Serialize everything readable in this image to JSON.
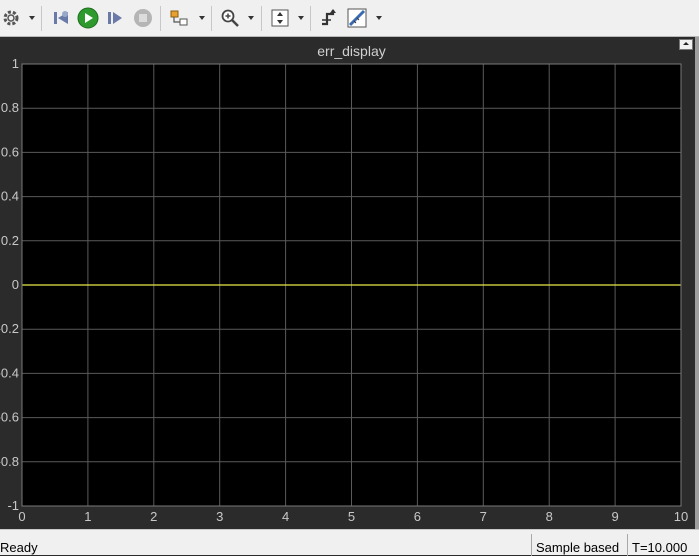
{
  "toolbar": {
    "items": [
      {
        "name": "settings-icon",
        "arrow": true
      },
      {
        "name": "step-back-icon"
      },
      {
        "name": "run-icon"
      },
      {
        "name": "step-forward-icon"
      },
      {
        "name": "stop-icon"
      },
      {
        "name": "highlight-block-icon",
        "arrow": true
      },
      {
        "name": "zoom-in-icon",
        "arrow": true
      },
      {
        "name": "scale-axes-icon",
        "arrow": true
      },
      {
        "name": "signal-trigger-icon"
      },
      {
        "name": "measurements-icon",
        "arrow": true
      }
    ]
  },
  "plot": {
    "title": "err_display",
    "background": "#000000",
    "grid_color": "#5a5a5a",
    "line_color": "#e8e84a",
    "tick_color": "#c8c8c8"
  },
  "chart_data": {
    "type": "line",
    "title": "err_display",
    "xlabel": "",
    "ylabel": "",
    "xlim": [
      0,
      10
    ],
    "ylim": [
      -1,
      1
    ],
    "x_ticks": [
      "0",
      "1",
      "2",
      "3",
      "4",
      "5",
      "6",
      "7",
      "8",
      "9",
      "10"
    ],
    "y_ticks": [
      "1",
      "0.8",
      "0.6",
      "0.4",
      "0.2",
      "0",
      "-0.2",
      "-0.4",
      "-0.6",
      "-0.8",
      "-1"
    ],
    "grid": true,
    "series": [
      {
        "x": [
          0,
          10
        ],
        "values": [
          0,
          0
        ],
        "color": "#e8e84a"
      }
    ]
  },
  "status": {
    "ready": "Ready",
    "mode": "Sample based",
    "time": "T=10.000"
  }
}
